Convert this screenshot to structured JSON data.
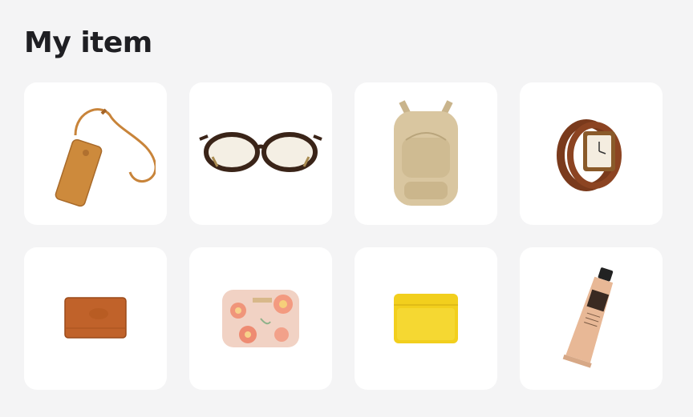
{
  "page": {
    "title": "My item"
  },
  "items": [
    {
      "id": "phone-pouch",
      "icon": "phone-shoulder-pouch-icon",
      "color": "#c8843a"
    },
    {
      "id": "eyeglasses",
      "icon": "eyeglasses-icon",
      "color": "#3a2418"
    },
    {
      "id": "backpack",
      "icon": "backpack-icon",
      "color": "#d9c6a0"
    },
    {
      "id": "wristwatch",
      "icon": "wristwatch-icon",
      "color": "#7a3a1c"
    },
    {
      "id": "leather-wallet",
      "icon": "leather-wallet-icon",
      "color": "#c0622a"
    },
    {
      "id": "floral-pouch",
      "icon": "floral-pouch-icon",
      "color": "#f1d2c4"
    },
    {
      "id": "yellow-wallet",
      "icon": "yellow-wallet-icon",
      "color": "#f2cf1d"
    },
    {
      "id": "hand-cream-tube",
      "icon": "hand-cream-tube-icon",
      "color": "#e8b896"
    }
  ]
}
